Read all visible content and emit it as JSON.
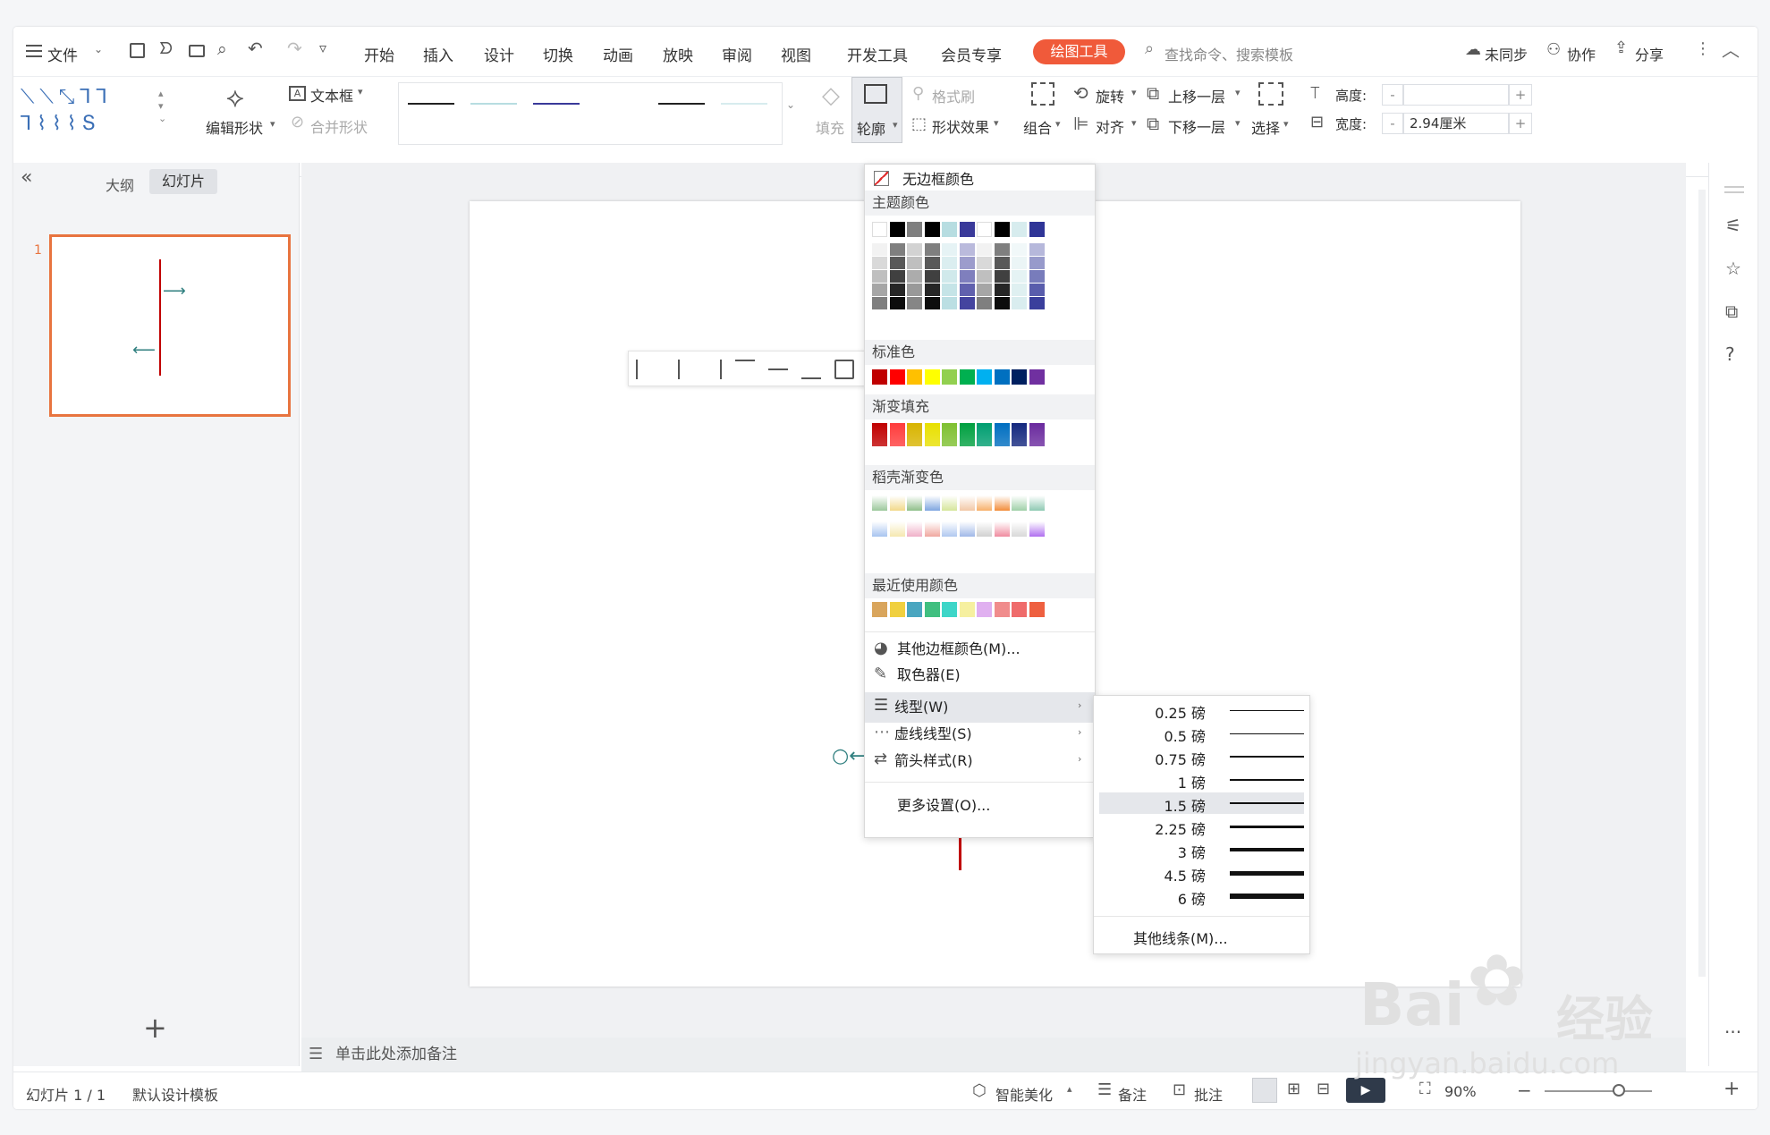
{
  "menu": {
    "file": "文件",
    "tabs": [
      "开始",
      "插入",
      "设计",
      "切换",
      "动画",
      "放映",
      "审阅",
      "视图",
      "开发工具",
      "会员专享"
    ],
    "draw_tools": "绘图工具",
    "search": "查找命令、搜索模板",
    "sync": "未同步",
    "collab": "协作",
    "share": "分享"
  },
  "ribbon": {
    "edit_shape": "编辑形状",
    "text_box": "文本框",
    "merge_shape": "合并形状",
    "fill": "填充",
    "outline": "轮廓",
    "format_brush": "格式刷",
    "shape_effect": "形状效果",
    "group": "组合",
    "rotate": "旋转",
    "align": "对齐",
    "bring_forward": "上移一层",
    "send_backward": "下移一层",
    "select": "选择",
    "height_label": "高度:",
    "width_label": "宽度:",
    "height_minus": "-",
    "height_plus": "+",
    "width_minus": "-",
    "width_plus": "+",
    "width_value": "2.94厘米"
  },
  "left_panel": {
    "collapse": "«",
    "tab_outline": "大纲",
    "tab_slides": "幻灯片",
    "slide_number": "1",
    "add": "+"
  },
  "notes_placeholder": "单击此处添加备注",
  "dropdown": {
    "no_border": "无边框颜色",
    "theme_colors": "主题颜色",
    "standard_colors": "标准色",
    "gradient_fill": "渐变填充",
    "docer_gradient": "稻壳渐变色",
    "recent_colors": "最近使用颜色",
    "more_colors": "其他边框颜色(M)...",
    "eyedropper": "取色器(E)",
    "line_type": "线型(W)",
    "dash_type": "虚线线型(S)",
    "arrow_style": "箭头样式(R)",
    "more_settings": "更多设置(O)...",
    "theme_top_row": [
      "#ffffff",
      "#000000",
      "#7f7f7f",
      "#000000",
      "#b7dde1",
      "#3a3a9a",
      "#ffffff",
      "#000000",
      "#d7ecee",
      "#2f3597"
    ],
    "standard_row": [
      "#c00000",
      "#ff0000",
      "#ffc000",
      "#ffff00",
      "#92d050",
      "#00b050",
      "#00b0f0",
      "#0070c0",
      "#002060",
      "#7030a0"
    ],
    "gradient_row": [
      "#c00000",
      "#ff3c3c",
      "#d8b400",
      "#e8e000",
      "#7ec030",
      "#00a040",
      "#009e70",
      "#006ec0",
      "#14287e",
      "#6a2a9e"
    ],
    "recent_row": [
      "#d9a55c",
      "#f0d040",
      "#4aa6c0",
      "#40bf80",
      "#3ed6c8",
      "#f6f0a0",
      "#e0b0f0",
      "#f08c8c",
      "#ef6b6b",
      "#ee6040"
    ]
  },
  "line_weights": {
    "items": [
      "0.25 磅",
      "0.5 磅",
      "0.75 磅",
      "1 磅",
      "1.5 磅",
      "2.25 磅",
      "3 磅",
      "4.5 磅",
      "6 磅"
    ],
    "selected": "1.5 磅",
    "more": "其他线条(M)..."
  },
  "status": {
    "slide": "幻灯片 1 / 1",
    "template": "默认设计模板",
    "beautify": "智能美化",
    "notes": "备注",
    "comment": "批注",
    "zoom": "90%"
  },
  "watermark": {
    "brand": "Bai",
    "brand_suffix": "经验",
    "url": "jingyan.baidu.com"
  },
  "colors": {
    "accent": "#f05a3a",
    "slide_line": "#c00000",
    "arrow": "#2f7f7f"
  }
}
